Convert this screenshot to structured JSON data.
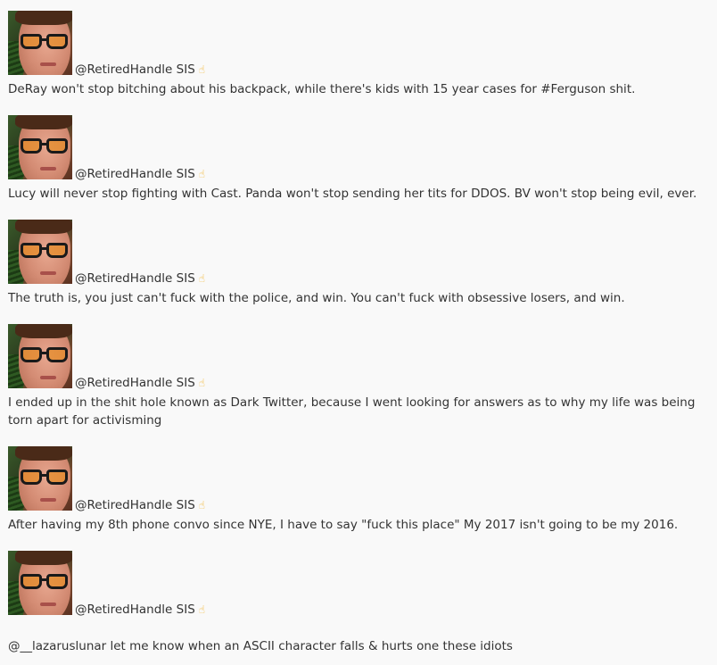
{
  "feed": {
    "tweets": [
      {
        "handle": "@RetiredHandle SIS",
        "finger_icon": "☝",
        "text": "DeRay won't stop bitching about his backpack, while there's kids with 15 year cases for #Ferguson shit."
      },
      {
        "handle": "@RetiredHandle SIS",
        "finger_icon": "☝",
        "text": "Lucy will never stop fighting with Cast. Panda won't stop sending her tits for DDOS. BV won't stop being evil, ever."
      },
      {
        "handle": "@RetiredHandle SIS",
        "finger_icon": "☝",
        "text": "The truth is, you just can't fuck with the police, and win. You can't fuck with obsessive losers, and win."
      },
      {
        "handle": "@RetiredHandle SIS",
        "finger_icon": "☝",
        "text": "I ended up in the shit hole known as Dark Twitter, because I went looking for answers as to why my life was being torn apart for activisming"
      },
      {
        "handle": "@RetiredHandle SIS",
        "finger_icon": "☝",
        "text": "After having my 8th phone convo since NYE, I have to say \"fuck this place\" My 2017 isn't going to be my 2016."
      },
      {
        "handle": "@RetiredHandle SIS",
        "finger_icon": "☝",
        "text": "@__lazaruslunar let me know when an ASCII character falls & hurts one these idiots"
      }
    ]
  }
}
